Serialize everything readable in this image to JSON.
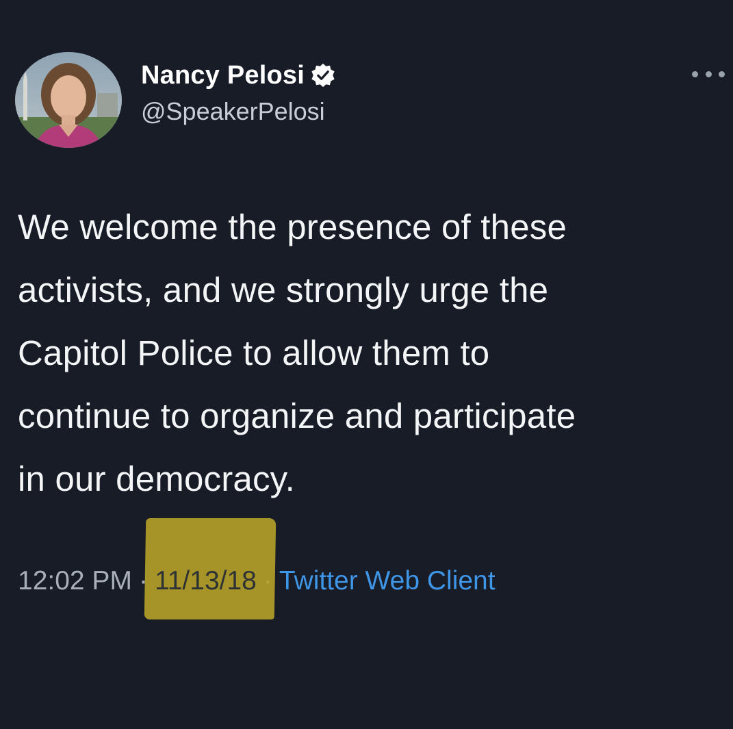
{
  "author": {
    "display_name": "Nancy Pelosi",
    "handle": "@SpeakerPelosi",
    "verified": true,
    "avatar_icon": "profile-photo"
  },
  "tweet": {
    "text": "We welcome the presence of these activists, and we strongly urge the Capitol Police to allow them to continue to organize and participate in our democracy.",
    "lines": [
      "We welcome the presence of these",
      "activists, and we strongly urge the",
      "Capitol Police to allow them to",
      "continue to organize and participate",
      "in our democracy."
    ]
  },
  "meta": {
    "time": "12:02 PM",
    "separator": "·",
    "date": "11/13/18",
    "source": "Twitter Web Client"
  },
  "colors": {
    "background": "#171c27",
    "link": "#3f95e6",
    "highlight": "#bba529",
    "verified_badge": "#ffffff"
  },
  "icons": {
    "more": "more-options-icon",
    "verified": "verified-badge-icon"
  }
}
